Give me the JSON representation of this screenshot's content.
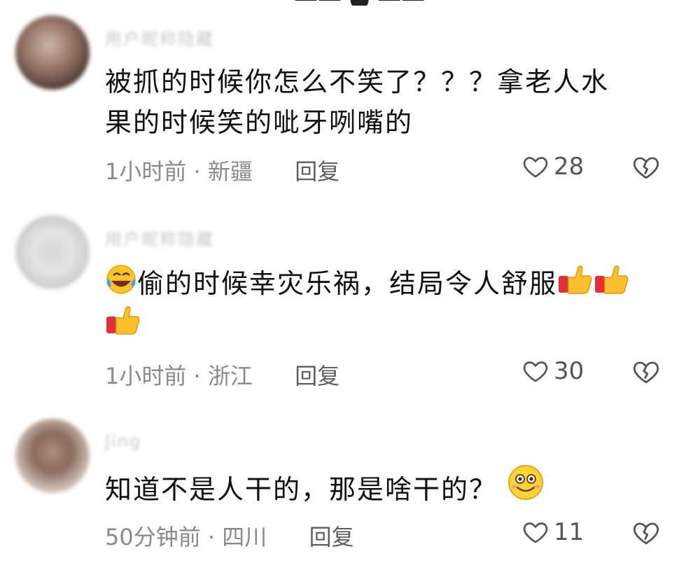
{
  "comments": [
    {
      "username": "用户昵称隐藏",
      "text_lines": [
        "被抓的时候你怎么不笑了？？？拿老人水",
        "果的时候笑的呲牙咧嘴的"
      ],
      "time": "1小时前",
      "location": "新疆",
      "reply_label": "回复",
      "likes": "28"
    },
    {
      "username": "用户昵称隐藏",
      "text_main": "偷的时候幸灾乐祸，结局令人舒服",
      "time": "1小时前",
      "location": "浙江",
      "reply_label": "回复",
      "likes": "30"
    },
    {
      "username": "Jing",
      "text_main": "知道不是人干的，那是啥干的？",
      "time": "50分钟前",
      "location": "四川",
      "reply_label": "回复",
      "likes": "11"
    }
  ],
  "separator": "·",
  "icons": {
    "like": "heart-outline-icon",
    "dislike": "broken-heart-icon",
    "laugh": "rofl-emoji-icon",
    "thumbs": "thumbs-up-emoji-icon",
    "smile": "smile-emoji-icon"
  },
  "colors": {
    "text": "#111111",
    "meta": "#8a8a8a",
    "icon": "#555555"
  }
}
